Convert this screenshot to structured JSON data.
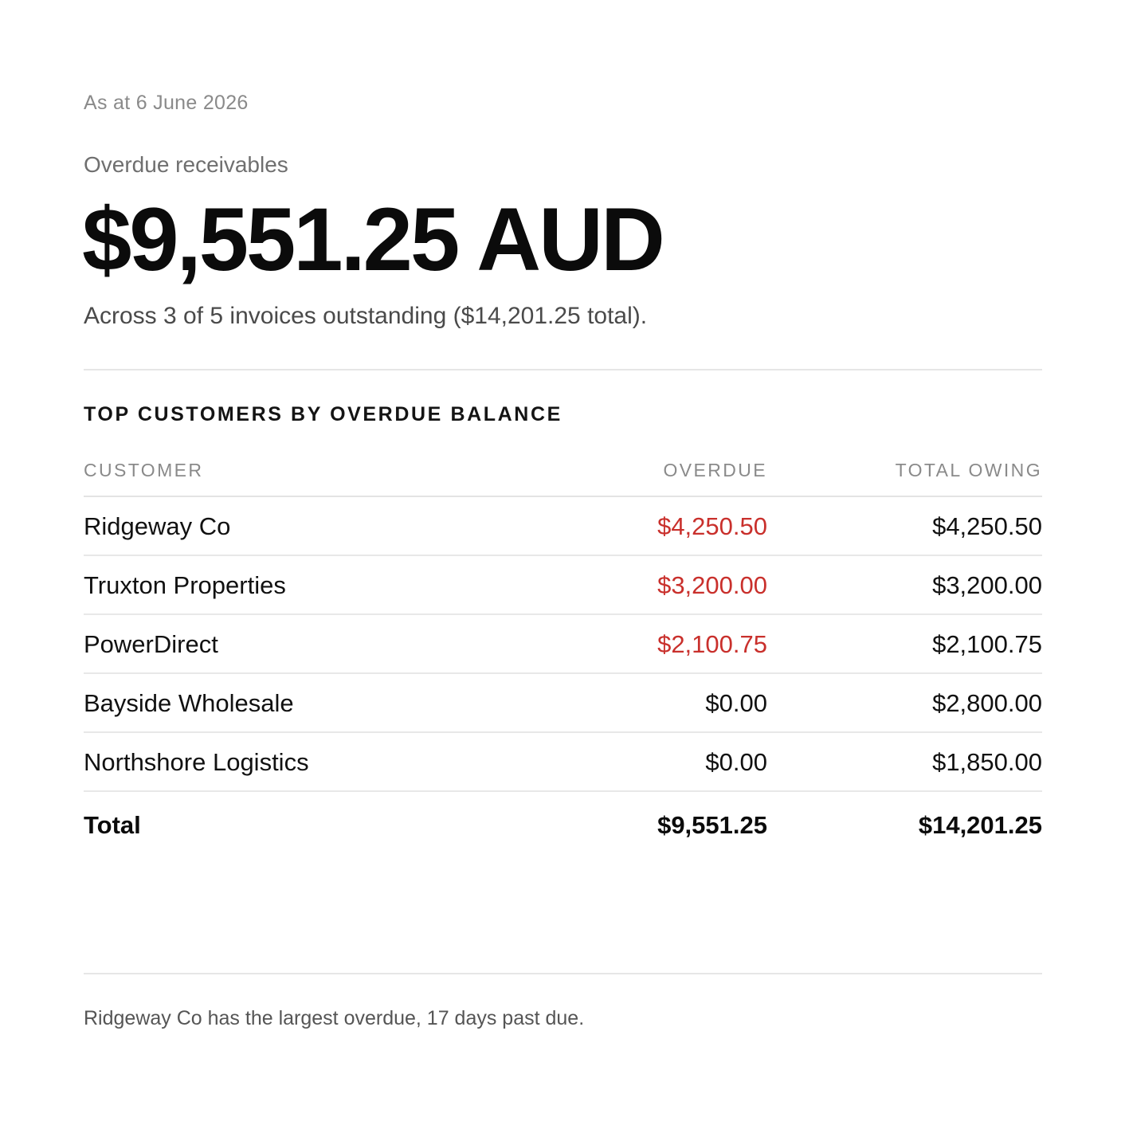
{
  "header": {
    "as_at": "As at 6 June 2026",
    "metric_label": "Overdue receivables",
    "metric_value": "$9,551.25 AUD",
    "metric_sub": "Across 3 of 5 invoices outstanding ($14,201.25 total)."
  },
  "section": {
    "title": "TOP CUSTOMERS BY OVERDUE BALANCE"
  },
  "table": {
    "columns": {
      "customer": "CUSTOMER",
      "overdue": "OVERDUE",
      "total_owing": "TOTAL OWING"
    },
    "rows": [
      {
        "customer": "Ridgeway Co",
        "overdue": "$4,250.50",
        "total_owing": "$4,250.50",
        "overdue_highlight": true
      },
      {
        "customer": "Truxton Properties",
        "overdue": "$3,200.00",
        "total_owing": "$3,200.00",
        "overdue_highlight": true
      },
      {
        "customer": "PowerDirect",
        "overdue": "$2,100.75",
        "total_owing": "$2,100.75",
        "overdue_highlight": true
      },
      {
        "customer": "Bayside Wholesale",
        "overdue": "$0.00",
        "total_owing": "$2,800.00",
        "overdue_highlight": false
      },
      {
        "customer": "Northshore Logistics",
        "overdue": "$0.00",
        "total_owing": "$1,850.00",
        "overdue_highlight": false
      }
    ],
    "total": {
      "label": "Total",
      "overdue": "$9,551.25",
      "total_owing": "$14,201.25"
    }
  },
  "footnote": "Ridgeway Co has the largest overdue, 17 days past due.",
  "colors": {
    "overdue_red": "#c9302c",
    "text_primary": "#111111",
    "text_muted": "#8a8a8a",
    "divider": "#e6e6e6"
  }
}
